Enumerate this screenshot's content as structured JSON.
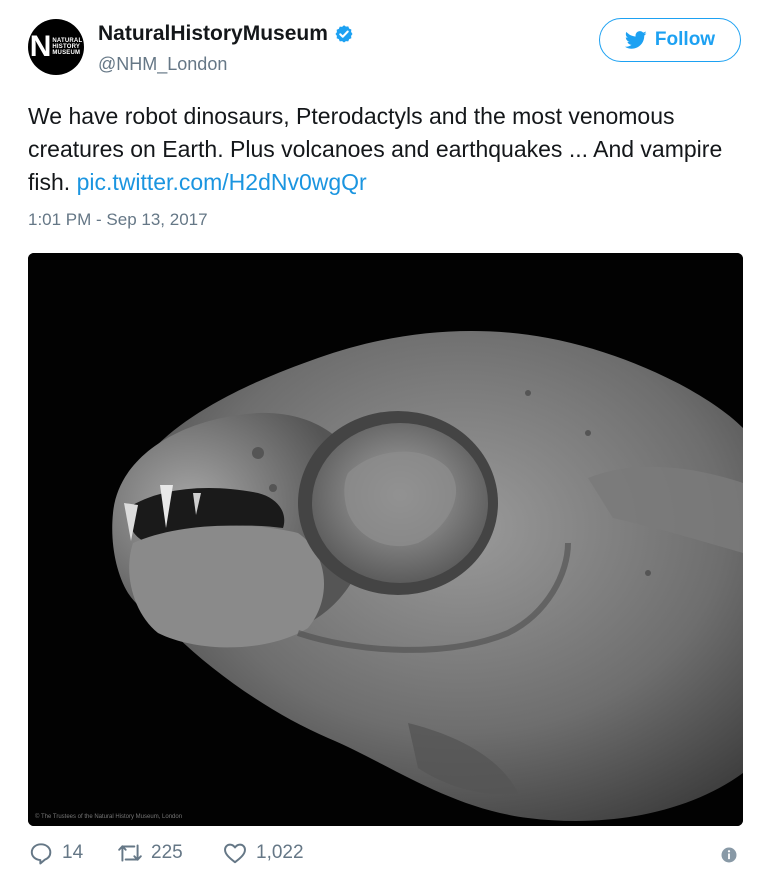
{
  "account": {
    "avatar_line1": "NATURAL",
    "avatar_line2": "HISTORY",
    "avatar_line3": "MUSEUM",
    "display_name": "NaturalHistoryMuseum",
    "handle": "@NHM_London",
    "verified": true
  },
  "follow_button": {
    "label": "Follow",
    "icon": "twitter-bird-icon"
  },
  "tweet": {
    "text": "We have robot dinosaurs, Pterodactyls and the most venomous creatures on Earth. Plus volcanoes and earthquakes ... And vampire fish. ",
    "link": "pic.twitter.com/H2dNv0wgQr",
    "timestamp": "1:01 PM - Sep 13, 2017"
  },
  "media": {
    "credit": "© The Trustees of the Natural History Museum, London"
  },
  "actions": {
    "replies": "14",
    "retweets": "225",
    "likes": "1,022"
  },
  "colors": {
    "accent": "#1da1f2",
    "link": "#1b95e0",
    "muted": "#657786",
    "text": "#14171a"
  }
}
